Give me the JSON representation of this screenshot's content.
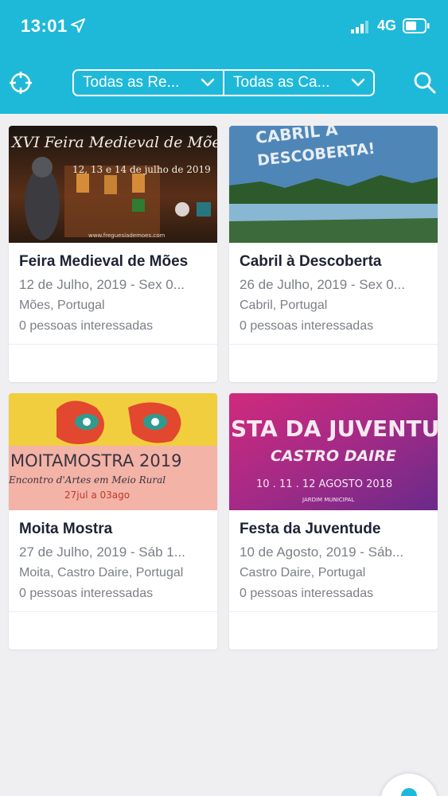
{
  "status_bar": {
    "time": "13:01",
    "network": "4G",
    "location_icon": "location-arrow-icon",
    "signal_icon": "signal-bars-icon",
    "battery_icon": "battery-icon"
  },
  "header": {
    "locate_icon": "crosshair-icon",
    "search_icon": "search-icon",
    "filters": [
      {
        "label": "Todas as Re...",
        "icon": "chevron-down-icon"
      },
      {
        "label": "Todas as Ca...",
        "icon": "chevron-down-icon"
      }
    ]
  },
  "events": [
    {
      "title": "Feira Medieval de Mões",
      "date": "12 de Julho, 2019 - Sex 0...",
      "location": "Mões, Portugal",
      "interested": "0 pessoas interessadas",
      "image": {
        "line1": "XVI Feira Medieval de Mões",
        "line2": "12, 13 e 14 de julho de 2019",
        "line3": "www.freguesiademoes.com"
      }
    },
    {
      "title": "Cabril à Descoberta",
      "date": "26 de Julho, 2019 - Sex 0...",
      "location": "Cabril, Portugal",
      "interested": "0 pessoas interessadas",
      "image": {
        "line1": "CABRIL À",
        "line2": "DESCOBERTA!"
      }
    },
    {
      "title": "Moita Mostra",
      "date": "27 de Julho, 2019 - Sáb 1...",
      "location": "Moita, Castro Daire, Portugal",
      "interested": "0 pessoas interessadas",
      "image": {
        "line1": "MOITAMOSTRA 2019",
        "line2": "Encontro d'Artes em Meio Rural",
        "line3": "27jul a 03ago"
      }
    },
    {
      "title": "Festa da Juventude",
      "date": "10 de Agosto, 2019 - Sáb...",
      "location": "Castro Daire, Portugal",
      "interested": "0 pessoas interessadas",
      "image": {
        "line1": "STA DA JUVENTU",
        "line2": "CASTRO DAIRE",
        "line3": "10 . 11 . 12 AGOSTO 2018",
        "line4": "JARDIM MUNICIPAL"
      }
    }
  ],
  "colors": {
    "header": "#1eb9d8",
    "background": "#efeff2",
    "title": "#1e2233",
    "meta": "#7b7f87"
  },
  "fab_icon": "map-pin-icon"
}
